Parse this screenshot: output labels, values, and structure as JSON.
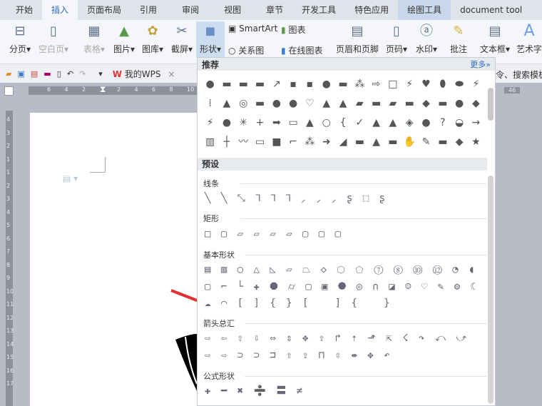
{
  "tabs": [
    "开始",
    "插入",
    "页面布局",
    "引用",
    "审阅",
    "视图",
    "章节",
    "开发工具",
    "特色应用",
    "绘图工具",
    "document tool"
  ],
  "ribbon": {
    "page_break": "分页",
    "blank_page": "空白页",
    "table": "表格",
    "picture": "图片",
    "gallery": "图库",
    "screenshot": "截屏",
    "shapes": "形状",
    "smartart": "SmartArt",
    "relation": "关系图",
    "chart": "图表",
    "online_chart": "在线图表",
    "header_footer": "页眉和页脚",
    "page_num": "页码",
    "watermark": "水印",
    "comment": "批注",
    "textbox": "文本框",
    "wordart": "艺术字"
  },
  "quickbar": {
    "doc_tab": "我的WPS",
    "close": "×",
    "search_hint": "令、搜索模板"
  },
  "ruler": {
    "h": [
      "6",
      "4",
      "2",
      "",
      "2",
      "4",
      "6",
      "8",
      "10"
    ],
    "v": [
      "4",
      "3",
      "2",
      "1",
      "1",
      "2",
      "3",
      "4",
      "5",
      "6",
      "7",
      "8",
      "9",
      "10",
      "11",
      "12",
      "13",
      "14",
      "15",
      "16",
      "17"
    ],
    "right": "46"
  },
  "panel": {
    "recommended": "推荐",
    "more": "更多»",
    "preset": "预设",
    "recommended_shapes": "●▬▬▬↗▪▪●▬⁂⇨□⚡♥⬮⬬⚡⁞▲◎▬●●♡▲▲▰▬▰▬◆▬●◆⚡●✳+➡▭▲○{✓▲▲◈●?◒→▥┼〰▭■⌐⁂➜◢▬▲▬✋✎▬◆★➾→",
    "sections": [
      {
        "title": "线条",
        "shapes": "╲╲⤡⅂⅂⅂⸝⸝⸝ʂ⬚ʂ"
      },
      {
        "title": "矩形",
        "shapes": "□▢▱▱▱▱▢▢▢"
      },
      {
        "title": "基本形状",
        "shapes": "▤▥○△◺▱⏢◇⬡⬠⑦⑧⑩⑫◔◖▢⌐└✚⯃⌭▢▣⯄◎∩◪☺♡✎⚙☾☁⌒[]{}[ ]{ }"
      },
      {
        "title": "箭头总汇",
        "shapes": "⇨⇦⇧⇩⇔⇕✥⇪↱⇡⬏⇱☇↷⤺⤻⇨⇨⊃⊃⊐⇧⇪⊓⇳⇼✥↶"
      },
      {
        "title": "公式形状",
        "shapes": "✚━✖➗〓≠"
      }
    ]
  }
}
